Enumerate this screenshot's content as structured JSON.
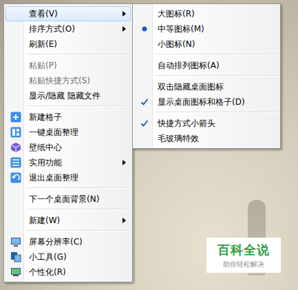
{
  "menu": {
    "items": [
      {
        "kind": "item",
        "label": "查看(V)",
        "has_submenu": true,
        "disabled": false,
        "selected": true,
        "has_icon": false
      },
      {
        "kind": "item",
        "label": "排序方式(O)",
        "has_submenu": true,
        "disabled": false,
        "selected": false,
        "has_icon": false
      },
      {
        "kind": "item",
        "label": "刷新(E)",
        "has_submenu": false,
        "disabled": false,
        "selected": false,
        "has_icon": false
      },
      {
        "kind": "separator"
      },
      {
        "kind": "item",
        "label": "粘贴(P)",
        "has_submenu": false,
        "disabled": true,
        "selected": false,
        "has_icon": false
      },
      {
        "kind": "item",
        "label": "粘贴快捷方式(S)",
        "has_submenu": false,
        "disabled": true,
        "selected": false,
        "has_icon": false
      },
      {
        "kind": "item",
        "label": "显示/隐藏 隐藏文件",
        "has_submenu": false,
        "disabled": false,
        "selected": false,
        "has_icon": false
      },
      {
        "kind": "separator"
      },
      {
        "kind": "item",
        "label": "新建格子",
        "has_submenu": false,
        "disabled": false,
        "selected": false,
        "has_icon": true
      },
      {
        "kind": "item",
        "label": "一键桌面整理",
        "has_submenu": false,
        "disabled": false,
        "selected": false,
        "has_icon": true
      },
      {
        "kind": "item",
        "label": "壁纸中心",
        "has_submenu": false,
        "disabled": false,
        "selected": false,
        "has_icon": true
      },
      {
        "kind": "item",
        "label": "实用功能",
        "has_submenu": true,
        "disabled": false,
        "selected": false,
        "has_icon": true
      },
      {
        "kind": "item",
        "label": "退出桌面整理",
        "has_submenu": false,
        "disabled": false,
        "selected": false,
        "has_icon": true
      },
      {
        "kind": "separator"
      },
      {
        "kind": "item",
        "label": "下一个桌面背景(N)",
        "has_submenu": false,
        "disabled": false,
        "selected": false,
        "has_icon": false
      },
      {
        "kind": "separator"
      },
      {
        "kind": "item",
        "label": "新建(W)",
        "has_submenu": true,
        "disabled": false,
        "selected": false,
        "has_icon": false
      },
      {
        "kind": "separator"
      },
      {
        "kind": "item",
        "label": "屏幕分辨率(C)",
        "has_submenu": false,
        "disabled": false,
        "selected": false,
        "has_icon": true
      },
      {
        "kind": "item",
        "label": "小工具(G)",
        "has_submenu": false,
        "disabled": false,
        "selected": false,
        "has_icon": true
      },
      {
        "kind": "item",
        "label": "个性化(R)",
        "has_submenu": false,
        "disabled": false,
        "selected": false,
        "has_icon": true
      }
    ]
  },
  "submenu": {
    "items": [
      {
        "kind": "item",
        "label": "大图标(R)",
        "bullet": false,
        "checked": false
      },
      {
        "kind": "item",
        "label": "中等图标(M)",
        "bullet": true,
        "checked": false
      },
      {
        "kind": "item",
        "label": "小图标(N)",
        "bullet": false,
        "checked": false
      },
      {
        "kind": "separator"
      },
      {
        "kind": "item",
        "label": "自动排列图标(A)",
        "bullet": false,
        "checked": false
      },
      {
        "kind": "separator"
      },
      {
        "kind": "item",
        "label": "双击隐藏桌面图标",
        "bullet": false,
        "checked": false
      },
      {
        "kind": "item",
        "label": "显示桌面图标和格子(D)",
        "bullet": false,
        "checked": true
      },
      {
        "kind": "separator"
      },
      {
        "kind": "item",
        "label": "快捷方式小箭头",
        "bullet": false,
        "checked": true
      },
      {
        "kind": "item",
        "label": "毛玻璃特效",
        "bullet": false,
        "checked": false
      }
    ]
  },
  "watermark": {
    "title": "百科全说",
    "subtitle": "助你轻松解决"
  }
}
